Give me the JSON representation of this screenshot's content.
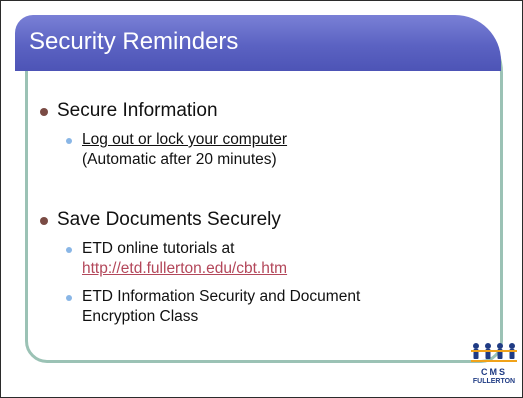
{
  "title": "Security Reminders",
  "sections": [
    {
      "heading": "Secure Information",
      "items": [
        {
          "line1": "Log out or lock your computer",
          "line2": "(Automatic after 20 minutes)"
        }
      ]
    },
    {
      "heading": "Save Documents Securely",
      "items": [
        {
          "line1": "ETD online tutorials at",
          "line2": "http://etd.fullerton.edu/cbt.htm"
        },
        {
          "line1": "ETD Information Security and Document",
          "line2": "Encryption Class"
        }
      ]
    }
  ],
  "logo": {
    "top": "CMS",
    "bottom": "FULLERTON"
  },
  "colors": {
    "title_bar": "#5b62c2",
    "frame": "#9bc2b5",
    "link": "#b3475a",
    "bullet_l1": "#7a4b44",
    "bullet_l2": "#89b6e6"
  }
}
